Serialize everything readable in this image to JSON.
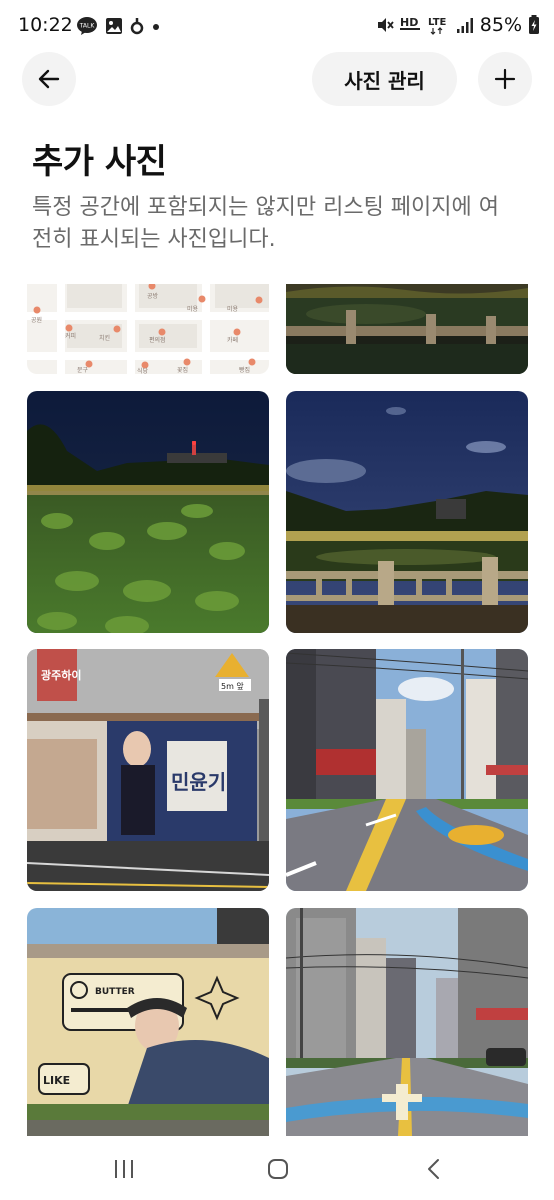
{
  "status_bar": {
    "time": "10:22",
    "battery": "85%",
    "network_label": "LTE",
    "hd_label": "HD",
    "talk_label": "TALK"
  },
  "nav": {
    "manage_label": "사진 관리"
  },
  "header": {
    "title": "추가 사진",
    "description": "특정 공간에 포함되지는 않지만 리스팅 페이지에 여전히 표시되는 사진입니다."
  },
  "photos": [
    {
      "subject": "map"
    },
    {
      "subject": "pond-bridge-night-crop"
    },
    {
      "subject": "pond-lotus-night"
    },
    {
      "subject": "pond-bridge-night"
    },
    {
      "subject": "mural-street"
    },
    {
      "subject": "city-street-day"
    },
    {
      "subject": "mural-butter"
    },
    {
      "subject": "city-street-buildings"
    }
  ],
  "map_labels": [
    "공방",
    "미용",
    "미용",
    "공원",
    "커피",
    "치킨",
    "편의점",
    "카페",
    "문구",
    "식당",
    "꽃집",
    "빵집"
  ],
  "mural_text": {
    "sign_left": "광주하이",
    "sign_right": "5m 앞",
    "poster": "민윤기",
    "butter_label": "BUTTER",
    "like_label": "LIKE"
  },
  "colors": {
    "pill_bg": "#f3f3f3",
    "title": "#111111",
    "description": "#6a6a6a"
  }
}
